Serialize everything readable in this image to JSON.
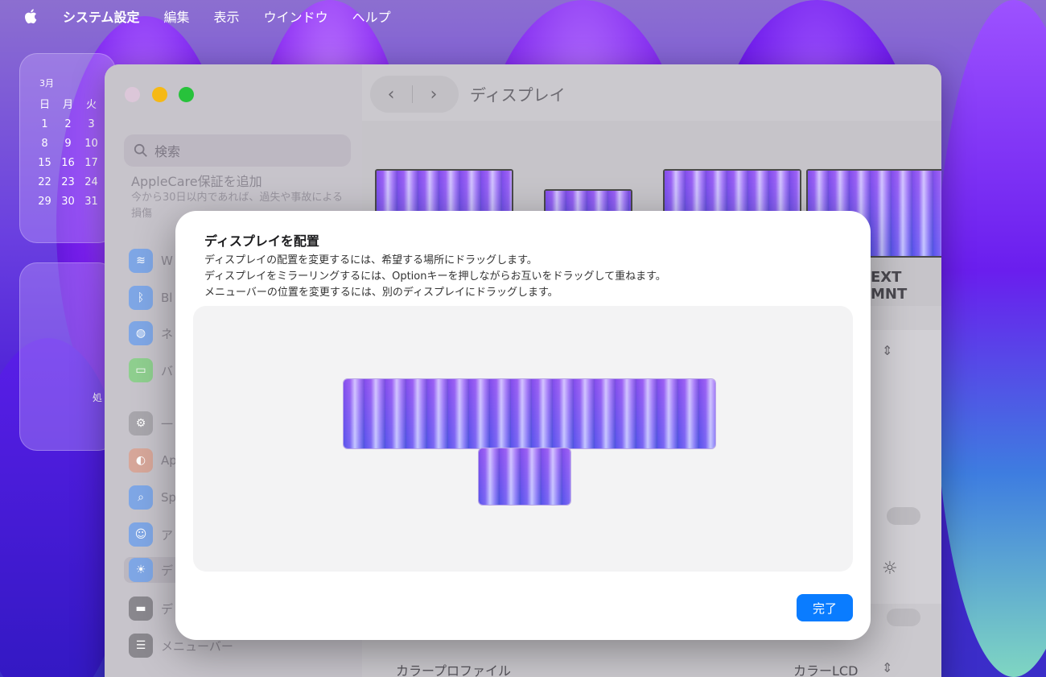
{
  "menubar": {
    "apple_icon": "apple-logo",
    "items": [
      "システム設定",
      "編集",
      "表示",
      "ウインドウ",
      "ヘルプ"
    ]
  },
  "calendar_widget": {
    "month": "3月",
    "weekdays": [
      "日",
      "月",
      "火"
    ],
    "rows": [
      [
        "1",
        "2",
        "3"
      ],
      [
        "8",
        "9",
        "10"
      ],
      [
        "15",
        "16",
        "17"
      ],
      [
        "22",
        "23",
        "24"
      ],
      [
        "29",
        "30",
        "31"
      ]
    ]
  },
  "second_widget": {
    "text": "処"
  },
  "sidebar": {
    "search_placeholder": "検索",
    "applecare_title": "AppleCare保証を追加",
    "applecare_sub": "今から30日以内であれば、過失や事故による損傷",
    "items": [
      {
        "label": "W",
        "icon": "wifi-icon",
        "color": "#3a8cf7"
      },
      {
        "label": "Bl",
        "icon": "bluetooth-icon",
        "color": "#3a8cf7"
      },
      {
        "label": "ネ",
        "icon": "globe-icon",
        "color": "#3a8cf7"
      },
      {
        "label": "バ",
        "icon": "battery-icon",
        "color": "#3cc34a"
      },
      {
        "label": "一",
        "icon": "general-icon",
        "color": "#8e8e93"
      },
      {
        "label": "Ap",
        "icon": "appearance-icon",
        "color": "#ff8a3d"
      },
      {
        "label": "Sp",
        "icon": "spotlight-icon",
        "color": "#3a8cf7"
      },
      {
        "label": "ア",
        "icon": "accessibility-icon",
        "color": "#3a8cf7"
      },
      {
        "label": "デ",
        "icon": "display-brightness-icon",
        "color": "#3a8cf7"
      },
      {
        "label": "デ",
        "icon": "desktop-dock-icon",
        "color": "#555"
      },
      {
        "label": "メニューバー",
        "icon": "menubar-icon",
        "color": "#555"
      }
    ]
  },
  "content": {
    "title": "ディスプレイ",
    "back_icon": "chevron-left-icon",
    "forward_icon": "chevron-right-icon",
    "ext_label": "EXT MNT",
    "color_profile_label": "カラープロファイル",
    "color_profile_value": "カラーLCD"
  },
  "dialog": {
    "title": "ディスプレイを配置",
    "lines": [
      "ディスプレイの配置を変更するには、希望する場所にドラッグします。",
      "ディスプレイをミラーリングするには、Optionキーを押しながらお互いをドラッグして重ねます。",
      "メニューバーの位置を変更するには、別のディスプレイにドラッグします。"
    ],
    "done_label": "完了",
    "accent_color": "#0a7cff"
  }
}
